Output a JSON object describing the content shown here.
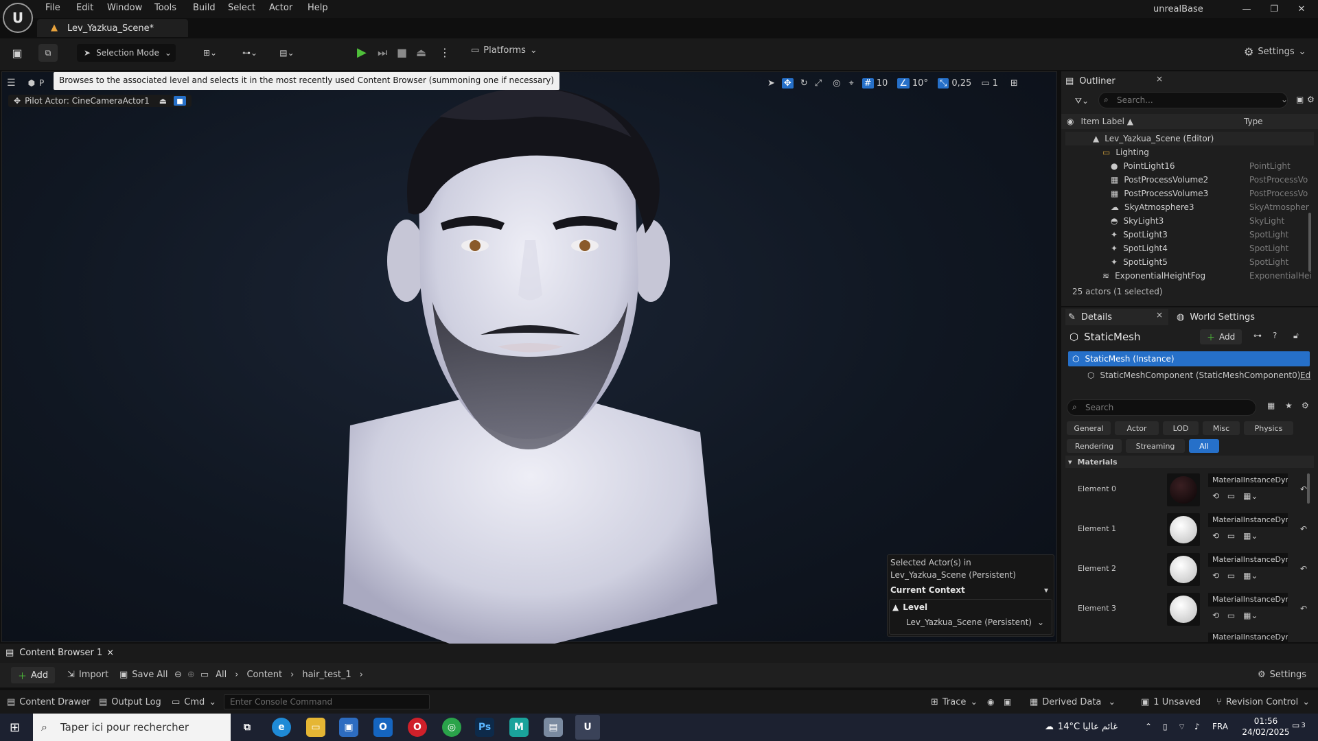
{
  "menubar": {
    "items": [
      "File",
      "Edit",
      "Window",
      "Tools",
      "Build",
      "Select",
      "Actor",
      "Help"
    ],
    "app_title": "unrealBase"
  },
  "level_tab": {
    "label": "Lev_Yazkua_Scene*"
  },
  "toolbar": {
    "selection_mode": "Selection Mode",
    "platforms": "Platforms",
    "settings": "Settings"
  },
  "viewport": {
    "tooltip": "Browses to the associated level and selects it in the most recently used Content Browser (summoning one if necessary)",
    "perspective_letter": "P",
    "pilot_label": "Pilot Actor: CineCameraActor1",
    "grid_value": "10",
    "angle_value": "10°",
    "scale_value": "0,25",
    "camera_speed": "1"
  },
  "context_panel": {
    "selected_line1": "Selected Actor(s) in",
    "selected_line2": "Lev_Yazkua_Scene (Persistent)",
    "current_context": "Current Context",
    "level_heading": "Level",
    "level_value": "Lev_Yazkua_Scene (Persistent)"
  },
  "outliner": {
    "title": "Outliner",
    "search_placeholder": "Search...",
    "col_label": "Item Label ▲",
    "col_type": "Type",
    "rows": [
      {
        "name": "Lev_Yazkua_Scene (Editor)",
        "type": ""
      },
      {
        "name": "Lighting",
        "type": ""
      },
      {
        "name": "PointLight16",
        "type": "PointLight"
      },
      {
        "name": "PostProcessVolume2",
        "type": "PostProcessVo"
      },
      {
        "name": "PostProcessVolume3",
        "type": "PostProcessVo"
      },
      {
        "name": "SkyAtmosphere3",
        "type": "SkyAtmospher"
      },
      {
        "name": "SkyLight3",
        "type": "SkyLight"
      },
      {
        "name": "SpotLight3",
        "type": "SpotLight"
      },
      {
        "name": "SpotLight4",
        "type": "SpotLight"
      },
      {
        "name": "SpotLight5",
        "type": "SpotLight"
      },
      {
        "name": "ExponentialHeightFog",
        "type": "ExponentialHei"
      }
    ],
    "footer": "25 actors (1 selected)"
  },
  "details": {
    "tab_details": "Details",
    "tab_world": "World Settings",
    "object_name": "StaticMesh",
    "add_label": "Add",
    "instance_row": "StaticMesh (Instance)",
    "component_row": "StaticMeshComponent (StaticMeshComponent0)",
    "component_edit": "Ed",
    "search_placeholder": "Search",
    "categories_row1": [
      "General",
      "Actor",
      "LOD",
      "Misc",
      "Physics"
    ],
    "categories_row2": [
      "Rendering",
      "Streaming",
      "All"
    ],
    "section_materials": "Materials",
    "materials": [
      {
        "label": "Element 0",
        "name": "MaterialInstanceDyna"
      },
      {
        "label": "Element 1",
        "name": "MaterialInstanceDyna"
      },
      {
        "label": "Element 2",
        "name": "MaterialInstanceDyna"
      },
      {
        "label": "Element 3",
        "name": "MaterialInstanceDyna"
      }
    ],
    "partial_material": "MaterialInstanceDyna"
  },
  "content_browser": {
    "tab": "Content Browser 1",
    "add": "Add",
    "import": "Import",
    "save_all": "Save All",
    "crumbs": [
      "All",
      "Content",
      "hair_test_1"
    ],
    "settings": "Settings"
  },
  "statusbar": {
    "content_drawer": "Content Drawer",
    "output_log": "Output Log",
    "cmd": "Cmd",
    "console_placeholder": "Enter Console Command",
    "trace": "Trace",
    "derived_data": "Derived Data",
    "unsaved": "1 Unsaved",
    "revision_control": "Revision Control"
  },
  "taskbar": {
    "search_placeholder": "Taper ici pour rechercher",
    "weather": "14°C  غائم عاليا",
    "lang": "FRA",
    "time": "01:56",
    "date": "24/02/2025",
    "notif_count": "3"
  }
}
